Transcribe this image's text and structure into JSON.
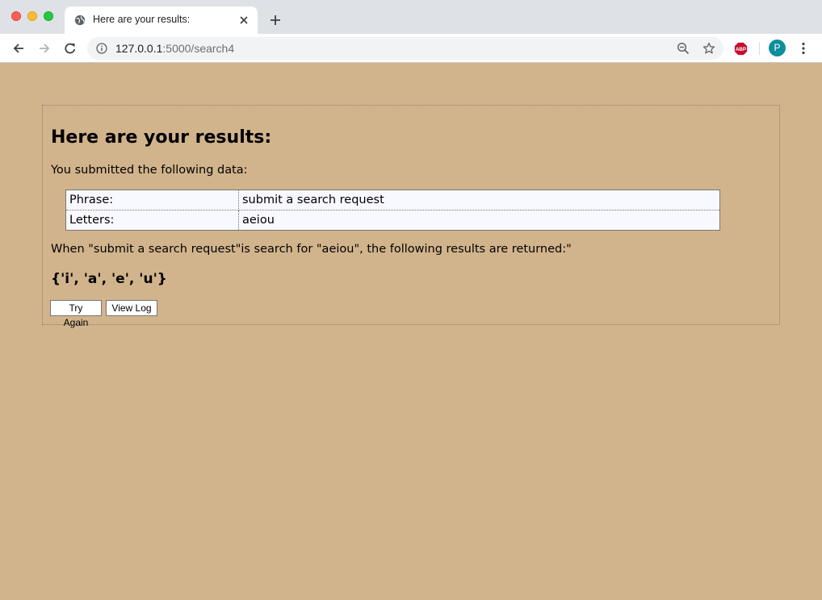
{
  "browser": {
    "tab": {
      "title": "Here are your results:"
    },
    "url": {
      "host": "127.0.0.1",
      "path": ":5000/search4"
    },
    "profile_initial": "P",
    "extension_label": "ABP"
  },
  "page": {
    "title": "Here are your results:",
    "intro": "You submitted the following data:",
    "table": [
      {
        "label": "Phrase:",
        "value": "submit a search request"
      },
      {
        "label": "Letters:",
        "value": "aeiou"
      }
    ],
    "result_sentence": "When \"submit a search request\"is search for \"aeiou\", the following results are returned:\"",
    "result_set": "{'i', 'a', 'e', 'u'}",
    "buttons": {
      "try_again": "Try Again",
      "view_log": "View Log"
    }
  },
  "colors": {
    "page_background": "#d2b48c",
    "table_background": "#f8f8ff",
    "avatar": "#0e8e9c",
    "abp": "#c70d2c"
  }
}
